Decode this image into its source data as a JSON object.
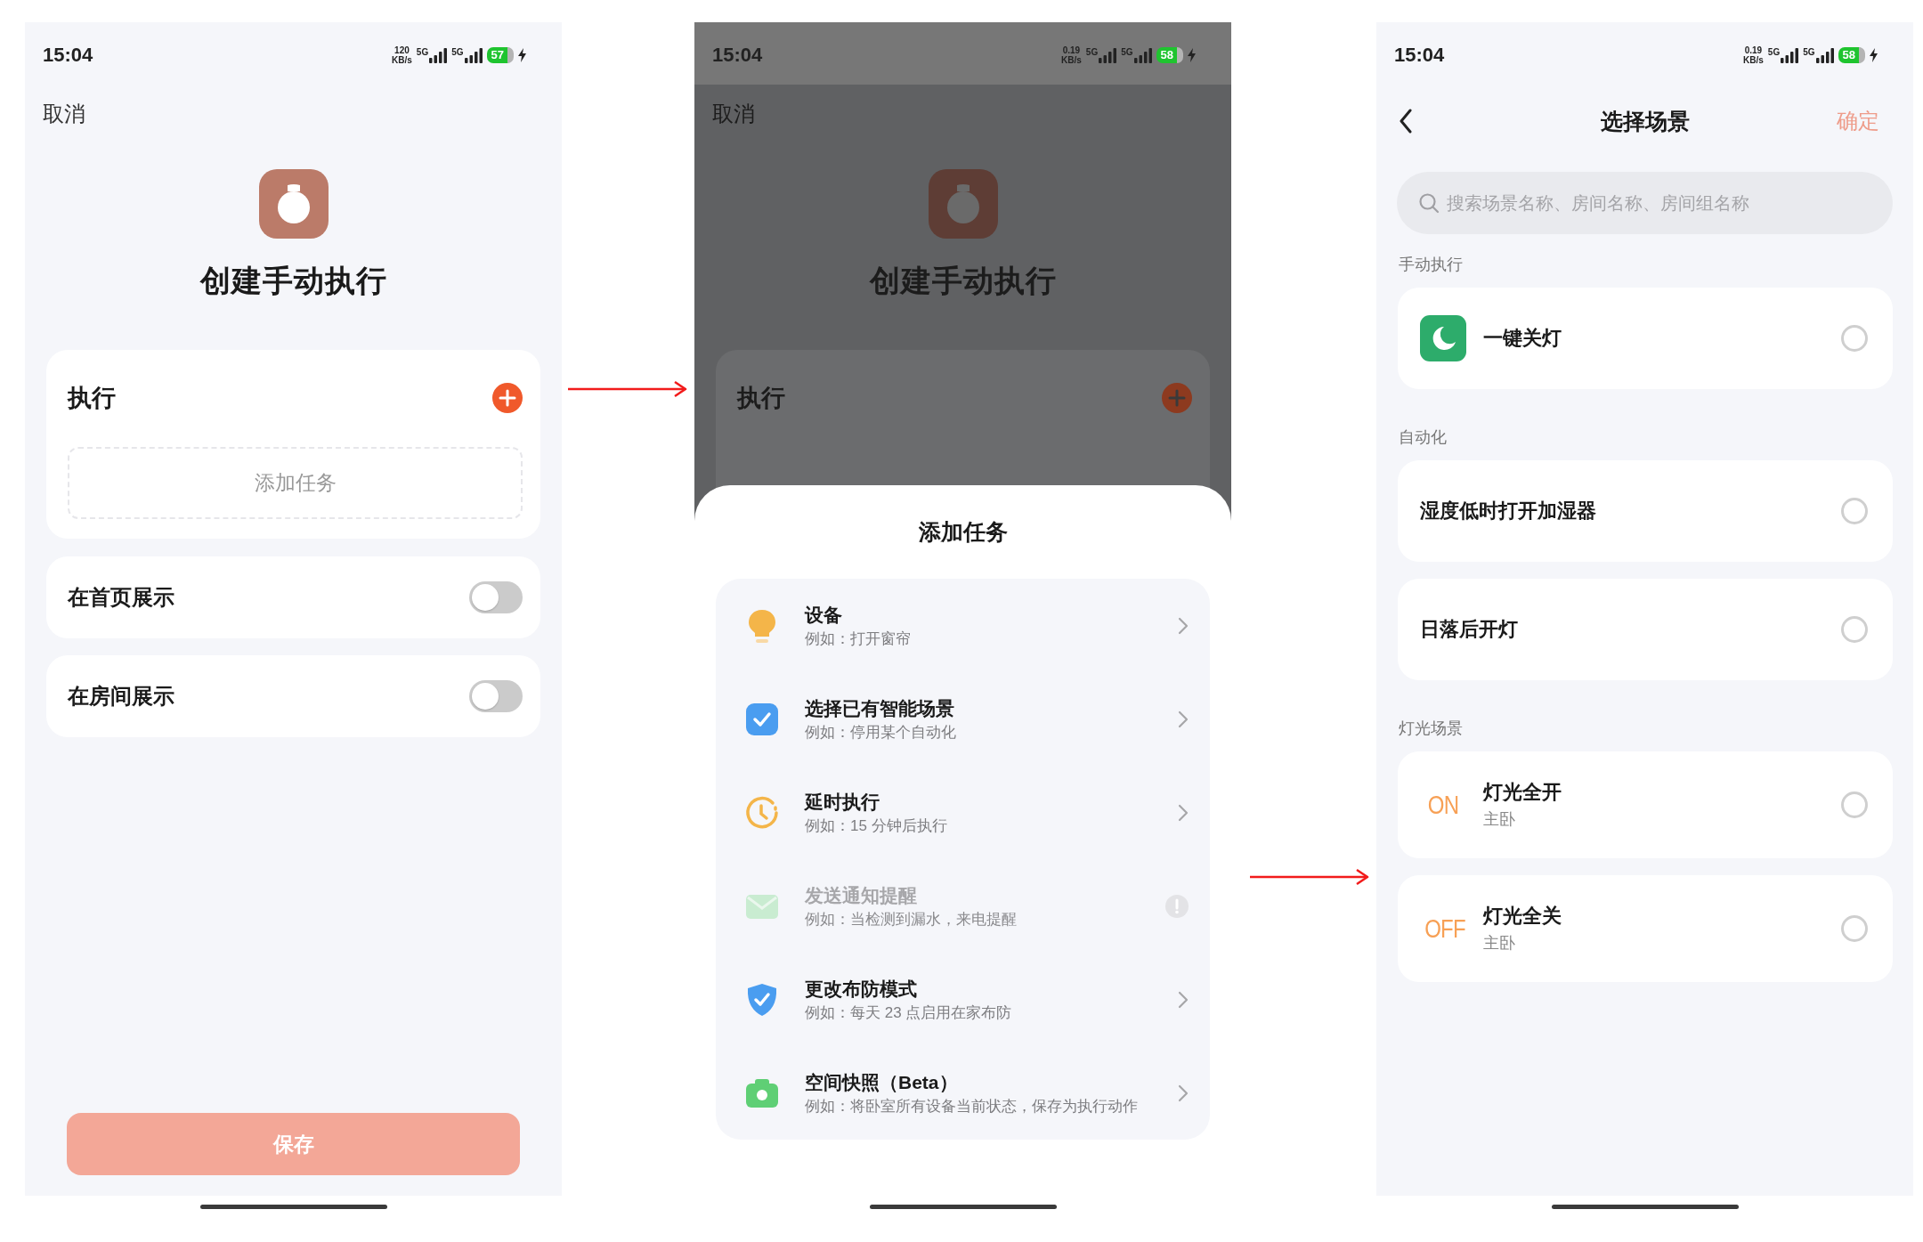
{
  "screens": [
    {
      "kind": "create",
      "status_bar": {
        "time": "15:04",
        "speed": "120",
        "speed_unit": "KB/s",
        "network_1": "5G",
        "network_2": "5G",
        "battery": "57"
      },
      "cancel": "取消",
      "title": "创建手动执行",
      "execute": {
        "title": "执行",
        "add_task": "添加任务"
      },
      "toggles": [
        {
          "label": "在首页展示",
          "on": false
        },
        {
          "label": "在房间展示",
          "on": false
        }
      ],
      "save": {
        "label": "保存",
        "disabled": true
      }
    },
    {
      "kind": "sheet",
      "status_bar": {
        "time": "15:04",
        "speed": "0.19",
        "speed_unit": "KB/s",
        "network_1": "5G",
        "network_2": "5G",
        "battery": "58"
      },
      "cancel": "取消",
      "title": "创建手动执行",
      "execute": {
        "title": "执行"
      },
      "sheet": {
        "title": "添加任务",
        "items": [
          {
            "title": "设备",
            "example": "例如：打开窗帘",
            "disabled": false
          },
          {
            "title": "选择已有智能场景",
            "example": "例如：停用某个自动化",
            "disabled": false
          },
          {
            "title": "延时执行",
            "example": "例如：15 分钟后执行",
            "disabled": false
          },
          {
            "title": "发送通知提醒",
            "example": "例如：当检测到漏水，来电提醒",
            "disabled": true
          },
          {
            "title": "更改布防模式",
            "example": "例如：每天 23 点启用在家布防",
            "disabled": false
          },
          {
            "title": "空间快照（Beta）",
            "example": "例如：将卧室所有设备当前状态，保存为执行动作",
            "disabled": false
          }
        ]
      }
    },
    {
      "kind": "picker",
      "status_bar": {
        "time": "15:04",
        "speed": "0.19",
        "speed_unit": "KB/s",
        "network_1": "5G",
        "network_2": "5G",
        "battery": "58"
      },
      "title": "选择场景",
      "confirm": {
        "label": "确定",
        "disabled": true
      },
      "search": {
        "placeholder": "搜索场景名称、房间名称、房间组名称"
      },
      "sections": [
        {
          "heading": "手动执行",
          "items": [
            {
              "kind": "icon",
              "title": "一键关灯",
              "selected": false
            }
          ]
        },
        {
          "heading": "自动化",
          "items": [
            {
              "kind": "plain",
              "title": "湿度低时打开加湿器",
              "selected": false
            },
            {
              "kind": "plain",
              "title": "日落后开灯",
              "selected": false
            }
          ]
        },
        {
          "heading": "灯光场景",
          "items": [
            {
              "kind": "badge",
              "badge": "ON",
              "title": "灯光全开",
              "subtitle": "主卧",
              "selected": false
            },
            {
              "kind": "badge",
              "badge": "OFF",
              "title": "灯光全关",
              "subtitle": "主卧",
              "selected": false
            }
          ]
        }
      ]
    }
  ]
}
